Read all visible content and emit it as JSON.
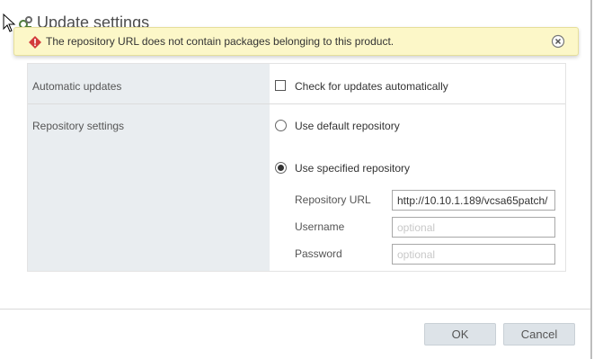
{
  "dialog": {
    "title": "Update settings"
  },
  "alert": {
    "message": "The repository URL does not contain packages belonging to this product."
  },
  "form": {
    "automatic_updates": {
      "label": "Automatic updates",
      "checkbox_label": "Check for updates automatically",
      "checked": false
    },
    "repository_settings": {
      "label": "Repository settings",
      "default_label": "Use default repository",
      "specified_label": "Use specified repository",
      "selected": "specified",
      "fields": {
        "url_label": "Repository URL",
        "url_value": "http://10.10.1.189/vcsa65patch/",
        "username_label": "Username",
        "username_placeholder": "optional",
        "password_label": "Password",
        "password_placeholder": "optional"
      }
    }
  },
  "footer": {
    "ok_label": "OK",
    "cancel_label": "Cancel"
  },
  "colors": {
    "alert_bg": "#fcf7c8",
    "error_red": "#d23b3b",
    "label_column_bg": "#e9edf0",
    "button_bg": "#dde3e8"
  },
  "icons": [
    "mouse-cursor-icon",
    "settings-icon",
    "error-icon",
    "close-icon"
  ]
}
